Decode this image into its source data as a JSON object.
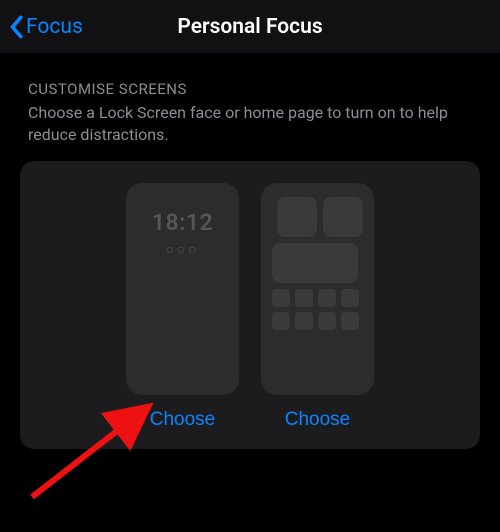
{
  "nav": {
    "back_label": "Focus",
    "title": "Personal Focus"
  },
  "section": {
    "header": "CUSTOMISE SCREENS",
    "description": "Choose a Lock Screen face or home page to turn on to help reduce distractions."
  },
  "tiles": {
    "lock_screen": {
      "time": "18:12",
      "dots": "○○○",
      "button": "Choose"
    },
    "home_screen": {
      "button": "Choose"
    }
  }
}
